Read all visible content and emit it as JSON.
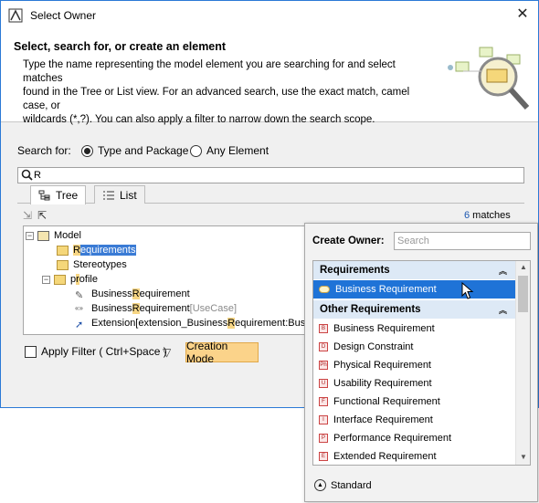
{
  "window": {
    "title": "Select Owner",
    "close_symbol": "✕"
  },
  "header": {
    "heading": "Select, search for, or create an element",
    "desc_line1": "Type the name representing the model element you are searching for and select matches",
    "desc_line2": "found in the Tree or List view. For an advanced search, use the exact match, camel case, or",
    "desc_line3": "wildcards (*,?). You can also apply a filter to narrow down the search scope."
  },
  "search": {
    "label": "Search for:",
    "option1": "Type and Package",
    "option2": "Any Element",
    "selected": "Type and Package",
    "value": "R"
  },
  "tabs": [
    {
      "label": "Tree",
      "active": true
    },
    {
      "label": "List",
      "active": false
    }
  ],
  "matches": {
    "count": "6",
    "suffix": " matches"
  },
  "tree": {
    "model": "Model",
    "req_pre": "R",
    "req_post": "equirements",
    "stereotypes": "Stereotypes",
    "prof_pre": "p",
    "prof_hl": "r",
    "prof_post": "ofile",
    "br1_pre": "Business ",
    "br1_hl": "R",
    "br1_post": "equirement",
    "br2_pre": "Business ",
    "br2_hl": "R",
    "br2_post": "equirement ",
    "br2_tag": "[UseCase]",
    "ext_pre": "Extension[extension_Business ",
    "ext_hl": "R",
    "ext_post": "equirement:Busi"
  },
  "bottom": {
    "filter_label": "Apply Filter ( Ctrl+Space )",
    "mode_button": "Creation Mode"
  },
  "popup": {
    "caption": "Create Owner:",
    "search_placeholder": "Search",
    "group1": "Requirements",
    "group1_item": "Business Requirement",
    "group2": "Other Requirements",
    "items": [
      {
        "badge": "B",
        "label": "Business Requirement"
      },
      {
        "badge": "D",
        "label": "Design Constraint"
      },
      {
        "badge": "Ph",
        "label": "Physical Requirement"
      },
      {
        "badge": "U",
        "label": "Usability Requirement"
      },
      {
        "badge": "F",
        "label": "Functional Requirement"
      },
      {
        "badge": "I",
        "label": "Interface Requirement"
      },
      {
        "badge": "P",
        "label": "Performance Requirement"
      },
      {
        "badge": "E",
        "label": "Extended Requirement"
      }
    ],
    "standard": "Standard"
  },
  "colors": {
    "selection": "#1f73d7",
    "highlight": "#f7d684",
    "creation_mode": "#fbd38a",
    "group_bg": "#dde9f6"
  }
}
